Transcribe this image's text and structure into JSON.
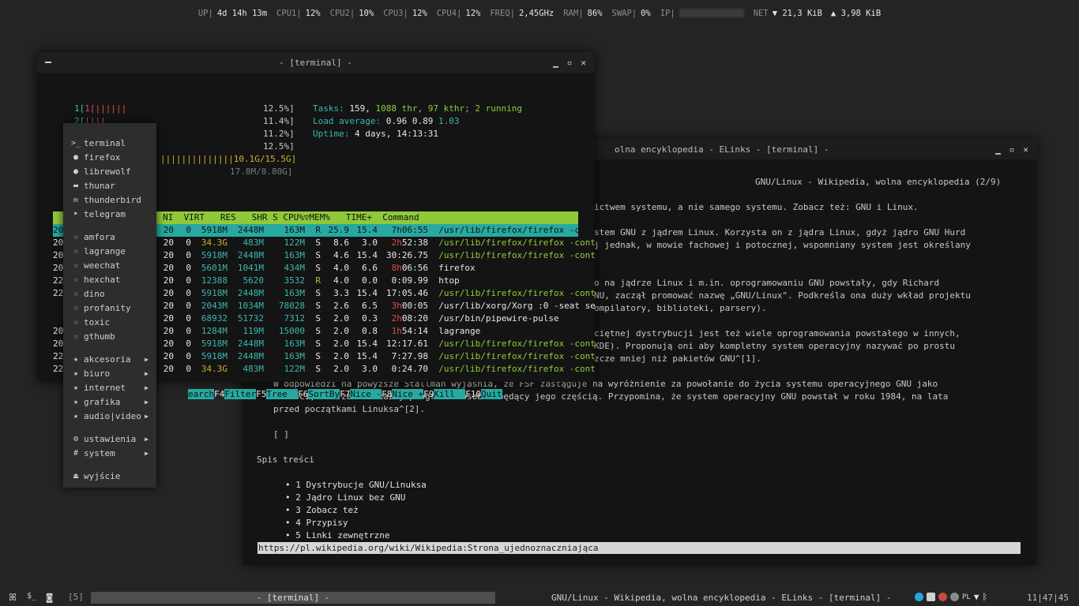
{
  "statusbar": {
    "up_label": "UP|",
    "up_value": "4d 14h 13m",
    "cpu1_label": "CPU1|",
    "cpu1_value": "12%",
    "cpu2_label": "CPU2|",
    "cpu2_value": "10%",
    "cpu3_label": "CPU3|",
    "cpu3_value": "12%",
    "cpu4_label": "CPU4|",
    "cpu4_value": "12%",
    "freq_label": "FREQ|",
    "freq_value": "2,45GHz",
    "ram_label": "RAM|",
    "ram_value": "86%",
    "swap_label": "SWAP|",
    "swap_value": "0%",
    "ip_label": "IP|",
    "net_label": "NET",
    "net_down": "▼ 21,3 KiB",
    "net_up": "▲ 3,98 KiB"
  },
  "terminal": {
    "title": "- [terminal] -",
    "cpu_lines": [
      "1[||||||",
      "2[||||",
      "",
      "",
      "||||||||||||||10.1G/15.5G]",
      "17.8M/8.80G]"
    ],
    "cpu_pcts": [
      "12.5%]",
      "11.4%]",
      "11.2%]",
      "12.5%]"
    ],
    "tasks_label": "Tasks:",
    "tasks_value": "159,",
    "thr_value": "1088 thr,",
    "kthr_value": "97 kthr;",
    "running_value": "2 running",
    "load_label": "Load average:",
    "load1": "0.96",
    "load5": "0.89",
    "load15": "1.03",
    "uptime_label": "Uptime:",
    "uptime_value": "4 days, 14:13:31",
    "header": "  PID USER      PRI  NI  VIRT   RES   SHR S CPU%▽MEM%   TIME+  Command",
    "rows": [
      {
        "pre": "20",
        "ni": "20",
        "virt": "0 5918M",
        "res": "2448M",
        "shr": "163M",
        "s": "R",
        "cpu": "25.9",
        "mem": "15.4",
        "time": "7h06:55",
        "cmd": "/usr/lib/firefox/firefox -cont"
      },
      {
        "pre": "20",
        "ni": "20",
        "virt": "0 34.3G",
        "res": "483M",
        "shr": "122M",
        "s": "S",
        "cpu": "8.6",
        "mem": "3.0",
        "time": "2h52:38",
        "cmd": "/usr/lib/firefox/firefox -cont"
      },
      {
        "pre": "20",
        "ni": "20",
        "virt": "0 5918M",
        "res": "2448M",
        "shr": "163M",
        "s": "S",
        "cpu": "4.6",
        "mem": "15.4",
        "time": "30:26.75",
        "cmd": "/usr/lib/firefox/firefox -cont"
      },
      {
        "pre": "20",
        "ni": "20",
        "virt": "0 5601M",
        "res": "1041M",
        "shr": "434M",
        "s": "S",
        "cpu": "4.0",
        "mem": "6.6",
        "time": "8h06:56",
        "cmd": "firefox"
      },
      {
        "pre": "22",
        "ni": "20",
        "virt": "0 12388",
        "res": "5620",
        "shr": "3532",
        "s": "R",
        "cpu": "4.0",
        "mem": "0.0",
        "time": "0:09.99",
        "cmd": "htop"
      },
      {
        "pre": "22",
        "ni": "20",
        "virt": "0 5918M",
        "res": "2448M",
        "shr": "163M",
        "s": "S",
        "cpu": "3.3",
        "mem": "15.4",
        "time": "17:05.46",
        "cmd": "/usr/lib/firefox/firefox -cont"
      },
      {
        "pre": "",
        "ni": "20",
        "virt": "0 2043M",
        "res": "1034M",
        "shr": "78028",
        "s": "S",
        "cpu": "2.6",
        "mem": "6.5",
        "time": "3h00:05",
        "cmd": "/usr/lib/xorg/Xorg :0 -seat se"
      },
      {
        "pre": "",
        "ni": "20",
        "virt": "0 68932",
        "res": "51732",
        "shr": "7312",
        "s": "S",
        "cpu": "2.0",
        "mem": "0.3",
        "time": "2h08:20",
        "cmd": "/usr/bin/pipewire-pulse"
      },
      {
        "pre": "20",
        "ni": "20",
        "virt": "0 1284M",
        "res": "119M",
        "shr": "15000",
        "s": "S",
        "cpu": "2.0",
        "mem": "0.8",
        "time": "1h54:14",
        "cmd": "lagrange"
      },
      {
        "pre": "20",
        "ni": "20",
        "virt": "0 5918M",
        "res": "2448M",
        "shr": "163M",
        "s": "S",
        "cpu": "2.0",
        "mem": "15.4",
        "time": "12:17.61",
        "cmd": "/usr/lib/firefox/firefox -cont"
      },
      {
        "pre": "22",
        "ni": "20",
        "virt": "0 5918M",
        "res": "2448M",
        "shr": "163M",
        "s": "S",
        "cpu": "2.0",
        "mem": "15.4",
        "time": "7:27.98",
        "cmd": "/usr/lib/firefox/firefox -cont"
      },
      {
        "pre": "22",
        "ni": "20",
        "virt": "0 34.3G",
        "res": "483M",
        "shr": "122M",
        "s": "S",
        "cpu": "2.0",
        "mem": "3.0",
        "time": "0:24.70",
        "cmd": "/usr/lib/firefox/firefox -cont"
      }
    ],
    "fkeys": [
      {
        "n": "F1",
        "l": ""
      },
      {
        "n": "",
        "l": "earch"
      },
      {
        "n": "F4",
        "l": "Filter"
      },
      {
        "n": "F5",
        "l": "Tree  "
      },
      {
        "n": "F6",
        "l": "SortBy"
      },
      {
        "n": "F7",
        "l": "Nice -"
      },
      {
        "n": "F8",
        "l": "Nice +"
      },
      {
        "n": "F9",
        "l": "Kill  "
      },
      {
        "n": "F10",
        "l": "Quit"
      }
    ]
  },
  "menu": {
    "apps": [
      {
        "icon": ">_",
        "label": "terminal",
        "icon_name": "terminal-icon"
      },
      {
        "icon": "●",
        "label": "firefox",
        "icon_name": "firefox-icon"
      },
      {
        "icon": "●",
        "label": "librewolf",
        "icon_name": "librewolf-icon"
      },
      {
        "icon": "▬",
        "label": "thunar",
        "icon_name": "folder-icon"
      },
      {
        "icon": "✉",
        "label": "thunderbird",
        "icon_name": "mail-icon"
      },
      {
        "icon": "➤",
        "label": "telegram",
        "icon_name": "telegram-icon"
      }
    ],
    "favs": [
      "amfora",
      "lagrange",
      "weechat",
      "hexchat",
      "dino",
      "profanity",
      "toxic",
      "gthumb"
    ],
    "categories": [
      "akcesoria",
      "biuro",
      "internet",
      "grafika",
      "audio|video"
    ],
    "settings": [
      {
        "icon": "⚙",
        "label": "ustawienia",
        "icon_name": "gear-icon"
      },
      {
        "icon": "#",
        "label": "system",
        "icon_name": "hash-icon"
      }
    ],
    "exit": {
      "icon": "⏏",
      "label": "wyjście"
    }
  },
  "elinks": {
    "title": "GNU/Linux - Wikipedia, wolna encyklopedia - ELinks - [terminal] -",
    "title_visible": "olna encyklopedia - ELinks - [terminal] -",
    "page_header": "GNU/Linux - Wikipedia, wolna encyklopedia (2/9)",
    "lines": [
      "ictwem systemu, a nie samego systemu. Zobacz też: GNU i Linux.",
      "stem GNU z jądrem Linux. Korzysta on z jądra Linux, gdyż jądro GNU Hurd",
      "j jednak, w mowie fachowej i potocznej, wspomniany system jest określany",
      "o na jądrze Linux i m.in. oprogramowaniu GNU powstały, gdy Richard",
      "NU, zaczął promować nazwę „GNU/Linux\". Podkreśla ona duży wkład projektu",
      "ompilatory, biblioteki, parsery).",
      "ciętnej dystrybucji jest też wiele oprogramowania powstałego w innych,",
      "KDE). Proponują oni aby kompletny system operacyjny nazywać po prostu",
      "zcze mniej niż pakietów GNU^[1].",
      "W odpowiedzi na powyższe Stallman wyjaśnia, że FSF zastąguje na wyróżnienie za powołanie do życia systemu operacyjnego GNU jako",
      "całości, nie zaś za każdy program z osobna będący jego częścią. Przypomina, że system operacyjny GNU powstał w roku 1984, na lata",
      "przed początkami Linuksa^[2].",
      "[ ]",
      "Spis treści",
      "• 1 Dystrybucje GNU/Linuksa",
      "• 2 Jądro Linux bez GNU",
      "• 3 Zobacz też",
      "• 4 Przypisy",
      "• 5 Linki zewnętrzne"
    ],
    "url": "https://pl.wikipedia.org/wiki/Wikipedia:Strona_ujednoznaczniająca"
  },
  "taskbar": {
    "workspace": "[5]",
    "active_task": "- [terminal] -",
    "task2": "GNU/Linux - Wikipedia, wolna encyklopedia - ELinks - [terminal] -",
    "lang": "PL",
    "clock": "11|47|45"
  }
}
